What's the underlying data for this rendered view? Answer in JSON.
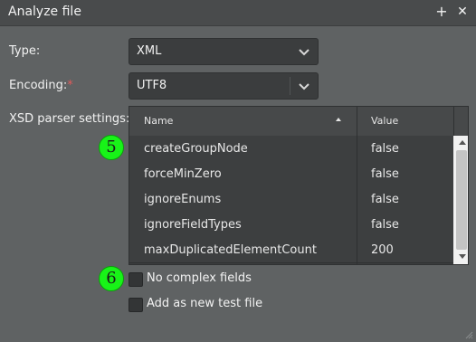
{
  "window": {
    "title": "Analyze file",
    "add_glyph": "+",
    "close_glyph": "✕"
  },
  "form": {
    "type_label": "Type:",
    "type_value": "XML",
    "encoding_label": "Encoding:",
    "encoding_required": "*",
    "encoding_value": "UTF8",
    "xsd_label": "XSD parser settings:"
  },
  "grid": {
    "columns": [
      "Name",
      "Value"
    ],
    "sort_column": "Name",
    "rows": [
      {
        "name": "createGroupNode",
        "value": "false"
      },
      {
        "name": "forceMinZero",
        "value": "false"
      },
      {
        "name": "ignoreEnums",
        "value": "false"
      },
      {
        "name": "ignoreFieldTypes",
        "value": "false"
      },
      {
        "name": "maxDuplicatedElementCount",
        "value": "200"
      }
    ]
  },
  "checkboxes": [
    {
      "label": "No complex fields",
      "checked": false
    },
    {
      "label": "Add as new test file",
      "checked": false
    }
  ],
  "annotations": {
    "marker_5": "5",
    "marker_6": "6"
  },
  "colors": {
    "badge": "#18f318",
    "background": "#5f6263",
    "field": "#3b3d3e",
    "required": "#e05a5a"
  },
  "icons": {
    "dropdown": "chevron-down-icon",
    "sort": "sort-ascending-icon",
    "add": "plus-icon",
    "close": "close-icon"
  }
}
